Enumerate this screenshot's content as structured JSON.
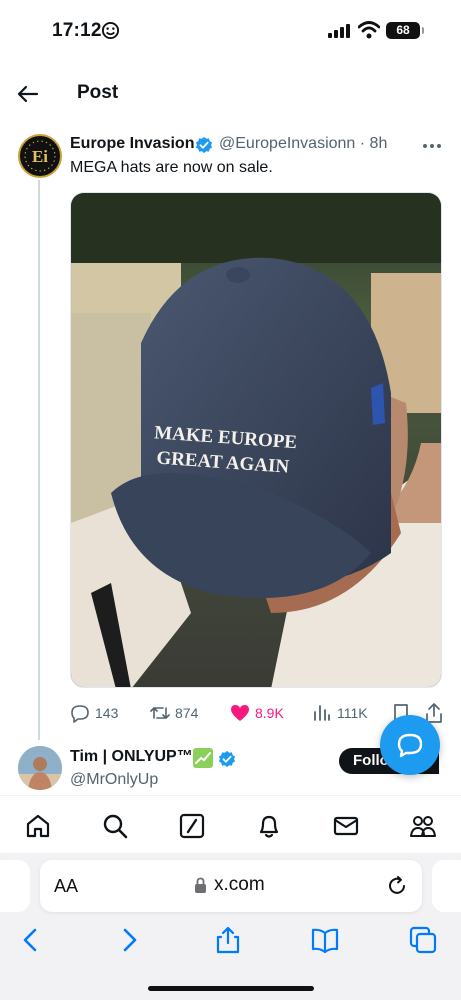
{
  "status_bar": {
    "time": "17:12",
    "battery": "68"
  },
  "header": {
    "title": "Post"
  },
  "tweet": {
    "author_name": "Europe Invasion",
    "handle_time": "@EuropeInvasionn · 8h",
    "text": "MEGA hats are now on sale.",
    "avatar_text": "Ei",
    "image_text_line1": "MAKE EUROPE",
    "image_text_line2": "GREAT AGAIN",
    "replies": "143",
    "retweets": "874",
    "likes": "8.9K",
    "views": "111K",
    "like_color": "#f91880"
  },
  "next_tweet": {
    "author_name": "Tim | ONLYUP™",
    "handle": "@MrOnlyUp",
    "follow_label": "Follow"
  },
  "tabbar": {
    "icons": [
      "home-icon",
      "search-icon",
      "grok-icon",
      "notifications-icon",
      "messages-icon",
      "communities-icon"
    ]
  },
  "browser": {
    "aa_label": "AA",
    "url": "x.com"
  },
  "colors": {
    "accent": "#1d9bf0",
    "text_secondary": "#536471"
  }
}
